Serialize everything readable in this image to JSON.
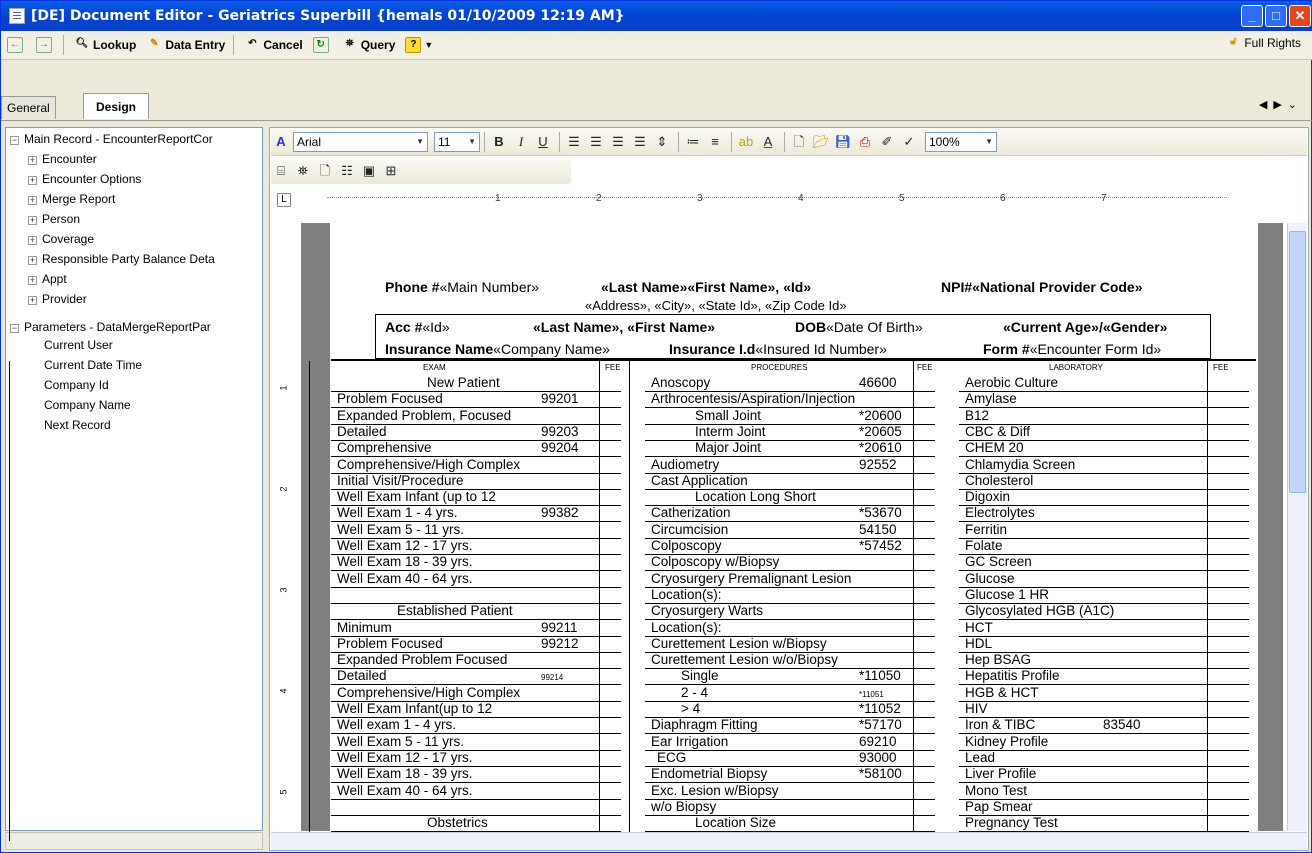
{
  "window": {
    "title": "[DE] Document Editor - Geriatrics Superbill {hemals 01/10/2009 12:19 AM}",
    "min": "_",
    "max": "□",
    "close": "✕"
  },
  "toolbar": {
    "lookup": "Lookup",
    "data_entry": "Data Entry",
    "cancel": "Cancel",
    "query": "Query",
    "full_rights": "Full Rights"
  },
  "tabs": {
    "general": "General",
    "design": "Design"
  },
  "tree": {
    "root": "Main Record - EncounterReportCor",
    "children": [
      "Encounter",
      "Encounter Options",
      "Merge Report",
      "Person",
      "Coverage",
      "Responsible Party Balance Deta",
      "Appt",
      "Provider"
    ],
    "params": "Parameters - DataMergeReportPar",
    "param_children": [
      "Current User",
      "Current Date Time",
      "Company Id",
      "Company Name",
      "Next Record"
    ]
  },
  "format": {
    "font": "Arial",
    "size": "11",
    "zoom": "100%"
  },
  "doc": {
    "phone_label": "Phone #",
    "phone_field": "«Main Number»",
    "name_field": "«Last Name»«First Name», «Id»",
    "npi_label": "NPI#",
    "npi_field": "«National Provider Code»",
    "address_line": "«Address», «City», «State Id», «Zip Code Id»",
    "acc_label": "Acc #",
    "acc_field": "«Id»",
    "name2": "«Last Name», «First Name»",
    "dob_label": "DOB",
    "dob_field": "«Date Of Birth»",
    "age_gender": "«Current Age»/«Gender»",
    "ins_label": "Insurance Name",
    "ins_field": "«Company Name»",
    "insid_label": "Insurance I.d",
    "insid_field": "«Insured Id Number»",
    "form_label": "Form #",
    "form_field": "«Encounter Form Id»",
    "col_exam": "EXAM",
    "col_fee": "FEE",
    "col_proc": "PROCEDURES",
    "col_lab": "LABORATORY"
  },
  "exam_rows": [
    {
      "t": "New Patient",
      "c": ""
    },
    {
      "t": "Problem Focused",
      "c": "99201"
    },
    {
      "t": "Expanded Problem, Focused",
      "c": ""
    },
    {
      "t": "Detailed",
      "c": "99203"
    },
    {
      "t": "Comprehensive",
      "c": "99204"
    },
    {
      "t": "Comprehensive/High  Complex",
      "c": ""
    },
    {
      "t": "Initial Visit/Procedure",
      "c": ""
    },
    {
      "t": "Well Exam Infant (up to 12",
      "c": ""
    },
    {
      "t": "Well Exam 1 - 4 yrs.",
      "c": "99382"
    },
    {
      "t": "Well Exam 5 - 11 yrs.",
      "c": ""
    },
    {
      "t": "Well Exam 12 - 17 yrs.",
      "c": ""
    },
    {
      "t": "Well Exam 18 - 39 yrs.",
      "c": ""
    },
    {
      "t": "Well Exam 40 - 64 yrs.",
      "c": ""
    },
    {
      "t": "",
      "c": ""
    },
    {
      "t": "Established  Patient",
      "c": ""
    },
    {
      "t": "Minimum",
      "c": "99211"
    },
    {
      "t": "Problem Focused",
      "c": "99212"
    },
    {
      "t": "Expanded Problem Focused",
      "c": ""
    },
    {
      "t": "Detailed",
      "c": "99214"
    },
    {
      "t": "Comprehensive/High Complex",
      "c": ""
    },
    {
      "t": "Well Exam Infant(up to 12",
      "c": ""
    },
    {
      "t": "Well exam 1 - 4 yrs.",
      "c": ""
    },
    {
      "t": "Well Exam 5 - 11 yrs.",
      "c": ""
    },
    {
      "t": "Well Exam 12 - 17 yrs.",
      "c": ""
    },
    {
      "t": "Well Exam 18 - 39 yrs.",
      "c": ""
    },
    {
      "t": "Well Exam 40 - 64 yrs.",
      "c": ""
    },
    {
      "t": "",
      "c": ""
    },
    {
      "t": "Obstetrics",
      "c": ""
    }
  ],
  "proc_rows": [
    {
      "t": "Anoscopy",
      "c": "46600"
    },
    {
      "t": "Arthrocentesis/Aspiration/Injection",
      "c": ""
    },
    {
      "t": "Small Joint",
      "c": "*20600"
    },
    {
      "t": "Interm Joint",
      "c": "*20605"
    },
    {
      "t": "Major Joint",
      "c": "*20610"
    },
    {
      "t": "Audiometry",
      "c": "92552"
    },
    {
      "t": "Cast Application",
      "c": ""
    },
    {
      "t": "Location      Long    Short",
      "c": ""
    },
    {
      "t": "Catherization",
      "c": "*53670"
    },
    {
      "t": "Circumcision",
      "c": "54150"
    },
    {
      "t": "Colposcopy",
      "c": "*57452"
    },
    {
      "t": "Colposcopy  w/Biopsy",
      "c": ""
    },
    {
      "t": "Cryosurgery  Premalignant  Lesion",
      "c": ""
    },
    {
      "t": "Location(s):",
      "c": ""
    },
    {
      "t": "Cryosurgery  Warts",
      "c": ""
    },
    {
      "t": "Location(s):",
      "c": ""
    },
    {
      "t": "Curettement  Lesion  w/Biopsy",
      "c": ""
    },
    {
      "t": "Curettement  Lesion  w/o/Biopsy",
      "c": ""
    },
    {
      "t": "Single",
      "c": "*11050"
    },
    {
      "t": "2 - 4",
      "c": "*11051"
    },
    {
      "t": "> 4",
      "c": "*11052"
    },
    {
      "t": "Diaphragm Fitting",
      "c": "*57170"
    },
    {
      "t": "Ear Irrigation",
      "c": "69210"
    },
    {
      "t": "ECG",
      "c": "93000"
    },
    {
      "t": "Endometrial Biopsy",
      "c": "*58100"
    },
    {
      "t": "Exc. Lesion w/Biopsy",
      "c": ""
    },
    {
      "t": "w/o Biopsy",
      "c": ""
    },
    {
      "t": "Location          Size",
      "c": ""
    }
  ],
  "lab_rows": [
    {
      "t": "Aerobic Culture",
      "c": ""
    },
    {
      "t": "Amylase",
      "c": ""
    },
    {
      "t": "B12",
      "c": ""
    },
    {
      "t": "CBC & Diff",
      "c": ""
    },
    {
      "t": "CHEM 20",
      "c": ""
    },
    {
      "t": "Chlamydia Screen",
      "c": ""
    },
    {
      "t": "Cholesterol",
      "c": ""
    },
    {
      "t": "Digoxin",
      "c": ""
    },
    {
      "t": "Electrolytes",
      "c": ""
    },
    {
      "t": "Ferritin",
      "c": ""
    },
    {
      "t": "Folate",
      "c": ""
    },
    {
      "t": "GC Screen",
      "c": ""
    },
    {
      "t": "Glucose",
      "c": ""
    },
    {
      "t": "Glucose 1 HR",
      "c": ""
    },
    {
      "t": "Glycosylated HGB (A1C)",
      "c": ""
    },
    {
      "t": "HCT",
      "c": ""
    },
    {
      "t": "HDL",
      "c": ""
    },
    {
      "t": "Hep BSAG",
      "c": ""
    },
    {
      "t": "Hepatitis Profile",
      "c": ""
    },
    {
      "t": "HGB & HCT",
      "c": ""
    },
    {
      "t": "HIV",
      "c": ""
    },
    {
      "t": "Iron & TIBC",
      "c": "83540"
    },
    {
      "t": "Kidney Profile",
      "c": ""
    },
    {
      "t": "Lead",
      "c": ""
    },
    {
      "t": "Liver Profile",
      "c": ""
    },
    {
      "t": "Mono Test",
      "c": ""
    },
    {
      "t": "Pap Smear",
      "c": ""
    },
    {
      "t": "Pregnancy Test",
      "c": ""
    }
  ],
  "ruler_nums": [
    "1",
    "2",
    "3",
    "4",
    "5",
    "6",
    "7"
  ],
  "vruler_nums": [
    "1",
    "2",
    "3",
    "4",
    "5"
  ]
}
